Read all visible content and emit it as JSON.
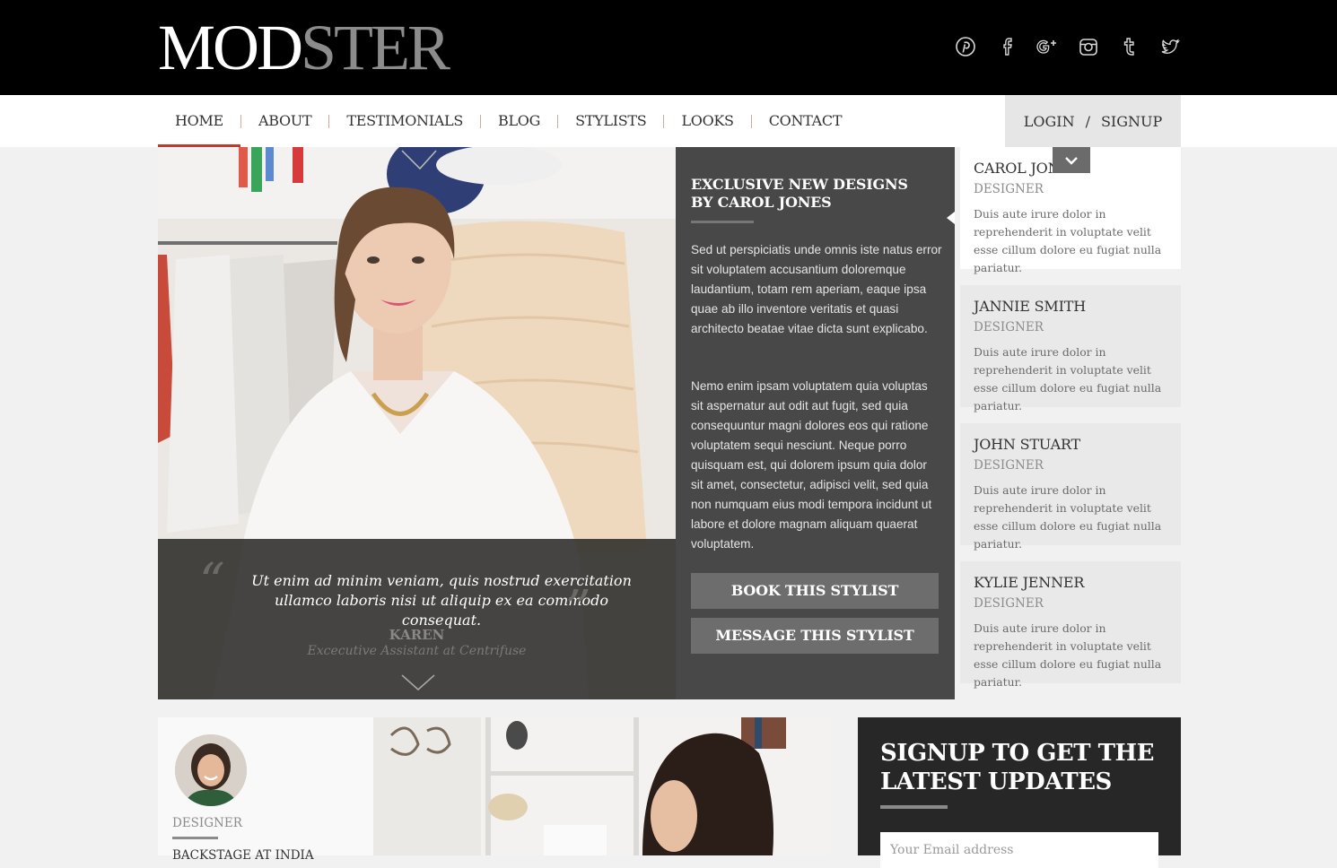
{
  "brand": {
    "logo_dark": "MOD",
    "logo_light": "STER"
  },
  "social": [
    "pinterest-icon",
    "facebook-icon",
    "google-plus-icon",
    "instagram-icon",
    "tumblr-icon",
    "twitter-icon"
  ],
  "nav": {
    "items": [
      "HOME",
      "ABOUT",
      "TESTIMONIALS",
      "BLOG",
      "STYLISTS",
      "LOOKS",
      "CONTACT"
    ],
    "active": "HOME",
    "login": "LOGIN",
    "separator": "/",
    "signup": "SIGNUP"
  },
  "testimonial": {
    "quote": "Ut enim ad minim veniam, quis nostrud exercitation ullamco laboris nisi ut aliquip ex ea commodo consequat.",
    "name": "KAREN",
    "role": "Excecutive Assistant at Centrifuse"
  },
  "feature": {
    "title": "EXCLUSIVE NEW DESIGNS BY CAROL JONES",
    "para1": "Sed ut perspiciatis unde omnis iste natus error sit voluptatem accusantium doloremque laudantium, totam rem aperiam, eaque ipsa quae ab illo inventore veritatis et quasi architecto beatae vitae dicta sunt explicabo.",
    "para2": "Nemo enim ipsam voluptatem quia voluptas sit aspernatur aut odit aut fugit, sed quia consequuntur magni dolores eos qui ratione voluptatem sequi nesciunt. Neque porro quisquam est, qui dolorem ipsum quia dolor sit amet, consectetur, adipisci velit, sed quia non numquam eius modi tempora incidunt ut labore et dolore magnam aliquam quaerat voluptatem.",
    "book_btn": "BOOK THIS STYLIST",
    "message_btn": "MESSAGE THIS STYLIST"
  },
  "stylists": [
    {
      "name": "CAROL JONES",
      "role": "DESIGNER",
      "desc": "Duis aute irure dolor in reprehenderit in voluptate velit esse cillum dolore eu fugiat nulla pariatur."
    },
    {
      "name": "JANNIE SMITH",
      "role": "DESIGNER",
      "desc": "Duis aute irure dolor in reprehenderit in voluptate velit esse cillum dolore eu fugiat nulla pariatur."
    },
    {
      "name": "JOHN STUART",
      "role": "DESIGNER",
      "desc": "Duis aute irure dolor in reprehenderit in voluptate velit esse cillum dolore eu fugiat nulla pariatur."
    },
    {
      "name": "KYLIE JENNER",
      "role": "DESIGNER",
      "desc": "Duis aute irure dolor in reprehenderit in voluptate velit esse cillum dolore eu fugiat nulla pariatur."
    }
  ],
  "post": {
    "label": "DESIGNER",
    "title": "BACKSTAGE AT INDIA"
  },
  "signup": {
    "title": "SIGNUP TO GET THE LATEST UPDATES",
    "placeholder": "Your Email address"
  },
  "colors": {
    "accent": "#c0392b",
    "header": "#000000",
    "panel": "#484848"
  }
}
